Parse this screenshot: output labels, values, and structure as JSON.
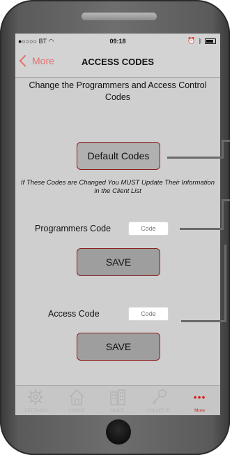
{
  "status_bar": {
    "carrier": "●○○○○ BT",
    "time": "09:18"
  },
  "nav": {
    "back_label": "More",
    "title": "ACCESS CODES"
  },
  "subtitle": "Change the Programmers and Access Control Codes",
  "default_button_label": "Default Codes",
  "warning_text": "If These Codes are Changed You MUST Update Their Information in the Client List",
  "programmers": {
    "label": "Programmers Code",
    "placeholder": "Code",
    "save_label": "SAVE"
  },
  "access": {
    "label": "Access Code",
    "placeholder": "Code",
    "save_label": "SAVE"
  },
  "tabs": [
    {
      "label": "SETTINGS",
      "icon": "gear-icon"
    },
    {
      "label": "SINGLE",
      "icon": "house-icon"
    },
    {
      "label": "MULTI",
      "icon": "building-icon"
    },
    {
      "label": "CALLER ID",
      "icon": "key-icon"
    },
    {
      "label": "More",
      "icon": "more-dots-icon",
      "glyph": "•••"
    }
  ],
  "colors": {
    "accent": "#e36f6f",
    "button_border": "#8a1e1e",
    "active_tab": "#d12020",
    "screen_bg": "#cfcfcf"
  }
}
